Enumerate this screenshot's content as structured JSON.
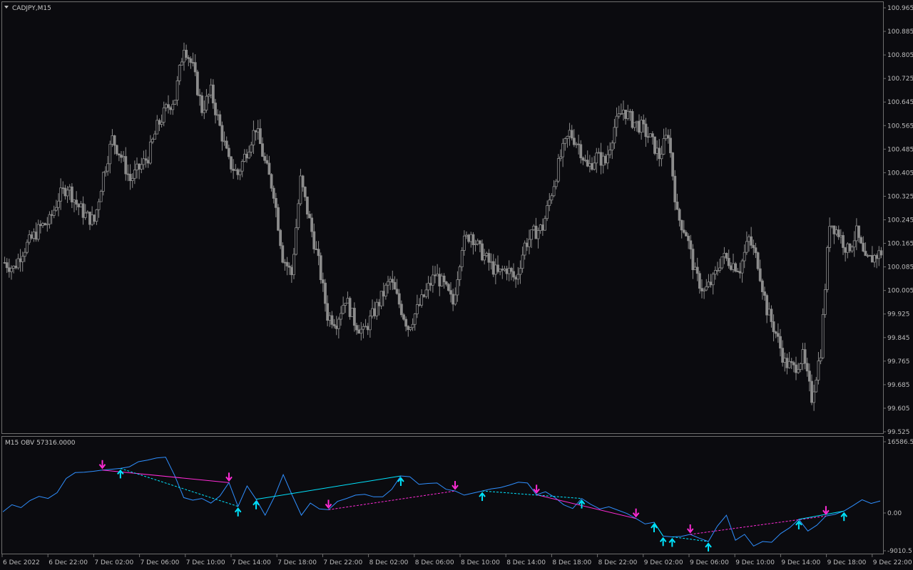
{
  "main_panel": {
    "symbol_label": "CADJPY,M15",
    "price_ticks": [
      "100.965",
      "100.885",
      "100.805",
      "100.725",
      "100.645",
      "100.565",
      "100.485",
      "100.405",
      "100.325",
      "100.245",
      "100.165",
      "100.085",
      "100.005",
      "99.925",
      "99.845",
      "99.765",
      "99.685",
      "99.605",
      "99.525"
    ]
  },
  "indicator_panel": {
    "label": "M15 OBV  57316.0000",
    "ticks": [
      "16586.5",
      "0.00",
      "-9010.5"
    ]
  },
  "time_ticks": [
    "6 Dec 2022",
    "6 Dec 22:00",
    "7 Dec 02:00",
    "7 Dec 06:00",
    "7 Dec 10:00",
    "7 Dec 14:00",
    "7 Dec 18:00",
    "7 Dec 22:00",
    "8 Dec 02:00",
    "8 Dec 06:00",
    "8 Dec 10:00",
    "8 Dec 14:00",
    "8 Dec 18:00",
    "8 Dec 22:00",
    "9 Dec 02:00",
    "9 Dec 06:00",
    "9 Dec 10:00",
    "9 Dec 14:00",
    "9 Dec 18:00",
    "9 Dec 22:00"
  ],
  "colors": {
    "background": "#0b0b0f",
    "candle": "#8c8c8c",
    "obv_line": "#2f8fff",
    "bull_signal": "#00e5ff",
    "bear_signal": "#ff2bd6",
    "frame": "#6e6e6e"
  },
  "chart_data": [
    {
      "type": "candlestick",
      "series_label": "CADJPY,M15",
      "ylim": [
        99.525,
        100.965
      ],
      "x_range": [
        "6 Dec 2022",
        "9 Dec 22:00+"
      ],
      "close_path": [
        [
          0,
          100.1
        ],
        [
          4,
          100.08
        ],
        [
          8,
          100.14
        ],
        [
          12,
          100.18
        ],
        [
          16,
          100.22
        ],
        [
          20,
          100.24
        ],
        [
          24,
          100.32
        ],
        [
          28,
          100.36
        ],
        [
          32,
          100.3
        ],
        [
          36,
          100.26
        ],
        [
          40,
          100.24
        ],
        [
          44,
          100.4
        ],
        [
          48,
          100.52
        ],
        [
          52,
          100.46
        ],
        [
          56,
          100.38
        ],
        [
          60,
          100.42
        ],
        [
          64,
          100.46
        ],
        [
          68,
          100.56
        ],
        [
          72,
          100.62
        ],
        [
          76,
          100.66
        ],
        [
          80,
          100.84
        ],
        [
          84,
          100.76
        ],
        [
          88,
          100.62
        ],
        [
          92,
          100.68
        ],
        [
          96,
          100.56
        ],
        [
          100,
          100.44
        ],
        [
          104,
          100.4
        ],
        [
          108,
          100.48
        ],
        [
          112,
          100.56
        ],
        [
          116,
          100.44
        ],
        [
          120,
          100.34
        ],
        [
          124,
          100.12
        ],
        [
          128,
          100.06
        ],
        [
          132,
          100.38
        ],
        [
          136,
          100.24
        ],
        [
          140,
          100.1
        ],
        [
          144,
          99.92
        ],
        [
          148,
          99.9
        ],
        [
          152,
          99.98
        ],
        [
          156,
          99.9
        ],
        [
          160,
          99.86
        ],
        [
          164,
          99.92
        ],
        [
          168,
          99.98
        ],
        [
          172,
          100.04
        ],
        [
          176,
          99.96
        ],
        [
          180,
          99.88
        ],
        [
          184,
          99.94
        ],
        [
          188,
          100.0
        ],
        [
          192,
          100.06
        ],
        [
          196,
          100.02
        ],
        [
          200,
          99.96
        ],
        [
          204,
          100.16
        ],
        [
          208,
          100.2
        ],
        [
          212,
          100.14
        ],
        [
          216,
          100.1
        ],
        [
          220,
          100.06
        ],
        [
          224,
          100.08
        ],
        [
          228,
          100.04
        ],
        [
          232,
          100.16
        ],
        [
          236,
          100.2
        ],
        [
          240,
          100.22
        ],
        [
          244,
          100.34
        ],
        [
          248,
          100.46
        ],
        [
          252,
          100.54
        ],
        [
          256,
          100.5
        ],
        [
          260,
          100.42
        ],
        [
          264,
          100.46
        ],
        [
          268,
          100.44
        ],
        [
          272,
          100.56
        ],
        [
          276,
          100.62
        ],
        [
          280,
          100.58
        ],
        [
          284,
          100.56
        ],
        [
          288,
          100.52
        ],
        [
          292,
          100.46
        ],
        [
          296,
          100.54
        ],
        [
          300,
          100.26
        ],
        [
          304,
          100.2
        ],
        [
          308,
          100.06
        ],
        [
          312,
          100.0
        ],
        [
          316,
          100.04
        ],
        [
          320,
          100.12
        ],
        [
          324,
          100.1
        ],
        [
          328,
          100.08
        ],
        [
          332,
          100.18
        ],
        [
          336,
          100.1
        ],
        [
          340,
          99.94
        ],
        [
          344,
          99.86
        ],
        [
          348,
          99.76
        ],
        [
          352,
          99.74
        ],
        [
          356,
          99.78
        ],
        [
          360,
          99.64
        ],
        [
          364,
          99.8
        ],
        [
          368,
          100.24
        ],
        [
          372,
          100.2
        ],
        [
          376,
          100.14
        ],
        [
          380,
          100.2
        ],
        [
          384,
          100.1
        ],
        [
          388,
          100.12
        ],
        [
          392,
          100.14
        ]
      ]
    },
    {
      "type": "line",
      "series_label": "M15 OBV",
      "ylim": [
        -9010.5,
        16586.5
      ],
      "values": [
        -200,
        1500,
        800,
        2500,
        3500,
        3000,
        4400,
        7800,
        9200,
        9300,
        9500,
        9800,
        10000,
        10200,
        10600,
        11800,
        12200,
        12700,
        12900,
        8500,
        3200,
        2600,
        3000,
        1900,
        3600,
        6800,
        1100,
        6000,
        2800,
        -1000,
        3300,
        8700,
        3700,
        -1000,
        1900,
        500,
        300,
        2300,
        3000,
        3800,
        4000,
        3400,
        3400,
        5200,
        8400,
        8200,
        6400,
        6600,
        6700,
        5200,
        4800,
        3800,
        4300,
        4800,
        5300,
        5600,
        6200,
        6900,
        6700,
        3900,
        4600,
        3300,
        1500,
        600,
        3000,
        1600,
        500,
        1000,
        200,
        -600,
        -1800,
        -3100,
        -2700,
        -6000,
        -6200,
        -6100,
        -5600,
        -6500,
        -7300,
        -3600,
        -1000,
        -7000,
        -5600,
        -8400,
        -7300,
        -7500,
        -5400,
        -4000,
        -2000,
        -4800,
        -3400,
        -1200,
        -800,
        0,
        1300,
        2700,
        1800,
        2400
      ],
      "bull_signal_indices": [
        13,
        26,
        28,
        44,
        53,
        64,
        72,
        73,
        74,
        78,
        88,
        93
      ],
      "bear_signal_indices": [
        11,
        25,
        36,
        50,
        59,
        70,
        76,
        91
      ]
    }
  ]
}
